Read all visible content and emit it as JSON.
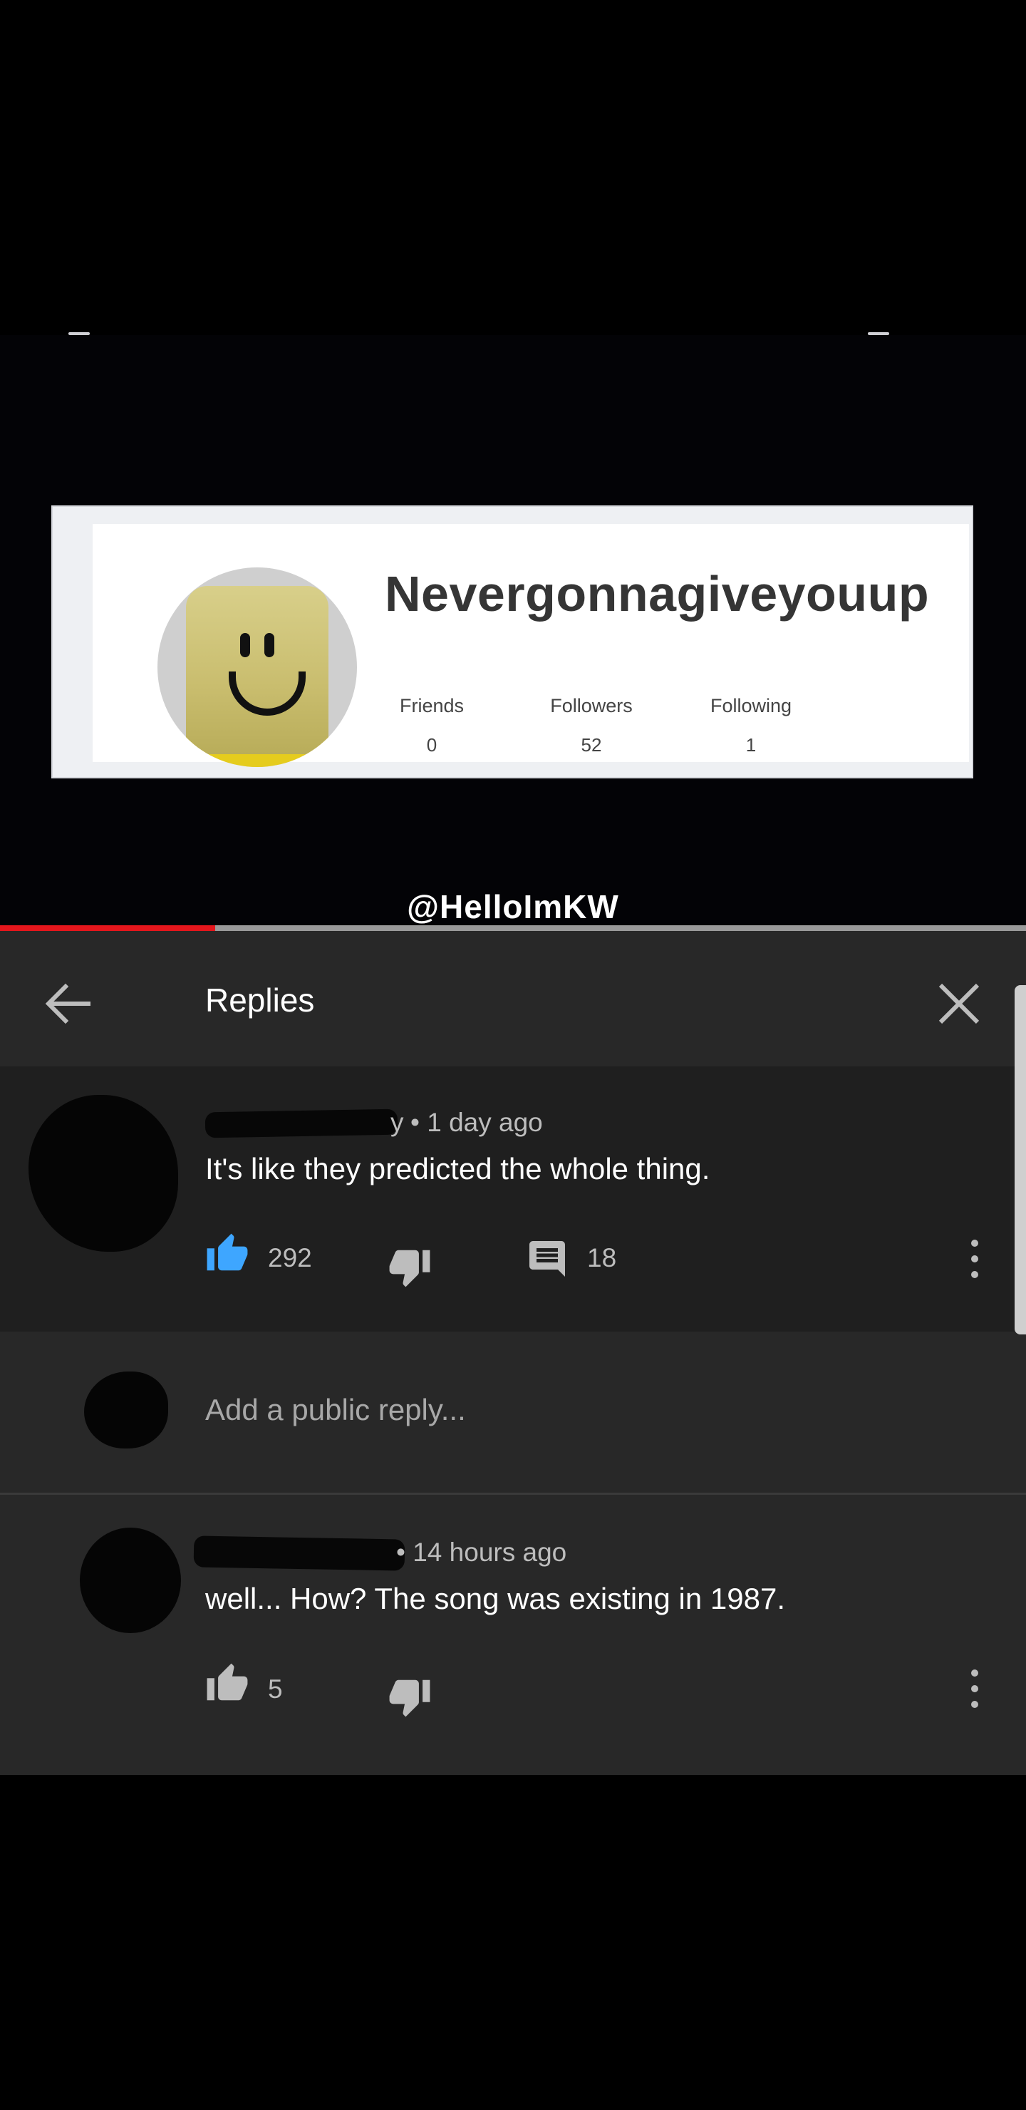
{
  "video": {
    "profile": {
      "username": "Nevergonnagiveyouup",
      "stats": [
        {
          "label": "Friends",
          "value": "0"
        },
        {
          "label": "Followers",
          "value": "52"
        },
        {
          "label": "Following",
          "value": "1"
        }
      ]
    },
    "watermark": "@HelloImKW",
    "progress_fraction": 0.21
  },
  "replies": {
    "title": "Replies",
    "main_comment": {
      "meta": "• 1 day ago",
      "author_fragment": "y",
      "text": "It's like they predicted the whole thing.",
      "likes": "292",
      "replies_count": "18"
    },
    "input": {
      "placeholder": "Add a public reply..."
    },
    "reply": {
      "meta": "• 14 hours ago",
      "text": "well... How? The song was existing in 1987.",
      "likes": "5"
    }
  },
  "colors": {
    "accent_like": "#3ea6ff",
    "progress": "#e5161c"
  }
}
